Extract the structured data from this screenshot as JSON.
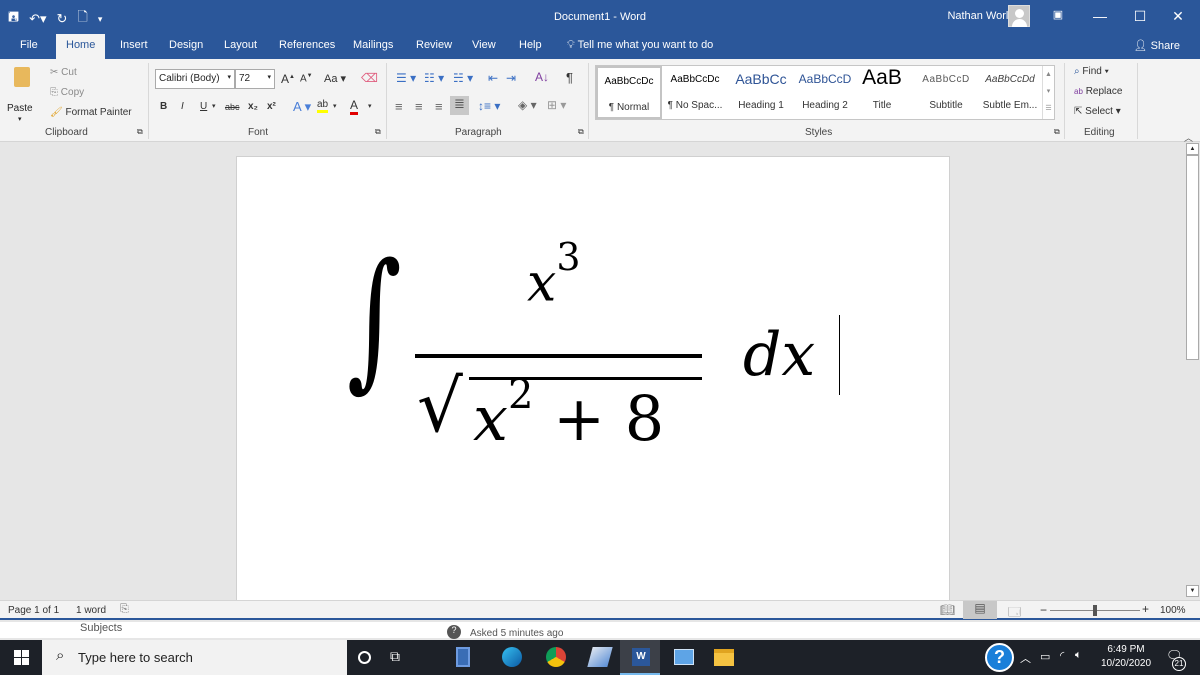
{
  "window": {
    "title": "Document1  -  Word",
    "user_name": "Nathan Worley"
  },
  "quick_access": [
    "save-icon",
    "undo-icon",
    "redo-icon",
    "print-preview-icon",
    "customize-icon"
  ],
  "tabs": [
    {
      "label": "File"
    },
    {
      "label": "Home",
      "active": true
    },
    {
      "label": "Insert"
    },
    {
      "label": "Design"
    },
    {
      "label": "Layout"
    },
    {
      "label": "References"
    },
    {
      "label": "Mailings"
    },
    {
      "label": "Review"
    },
    {
      "label": "View"
    },
    {
      "label": "Help"
    }
  ],
  "tell_me": "Tell me what you want to do",
  "share_label": "Share",
  "ribbon": {
    "clipboard": {
      "paste": "Paste",
      "cut": "Cut",
      "copy": "Copy",
      "format_painter": "Format Painter",
      "label": "Clipboard"
    },
    "font": {
      "name": "Calibri (Body)",
      "size": "72",
      "label": "Font",
      "change_case": "Aa",
      "bold": "B",
      "italic": "I",
      "underline": "U",
      "strike": "abc",
      "sub": "x₂",
      "sup": "x²"
    },
    "paragraph": {
      "label": "Paragraph"
    },
    "styles": {
      "label": "Styles",
      "items": [
        {
          "preview": "AaBbCcDc",
          "name": "¶ Normal"
        },
        {
          "preview": "AaBbCcDc",
          "name": "¶ No Spac..."
        },
        {
          "preview": "AaBbCc",
          "name": "Heading 1"
        },
        {
          "preview": "AaBbCcD",
          "name": "Heading 2"
        },
        {
          "preview": "AaB",
          "name": "Title"
        },
        {
          "preview": "AaBbCcD",
          "name": "Subtitle"
        },
        {
          "preview": "AaBbCcDd",
          "name": "Subtle Em..."
        }
      ]
    },
    "editing": {
      "find": "Find",
      "replace": "Replace",
      "select": "Select",
      "label": "Editing"
    }
  },
  "document": {
    "equation": {
      "integral": "∫",
      "numerator_base": "x",
      "numerator_exp": "3",
      "denominator_base": "x",
      "denominator_exp": "2",
      "denominator_rest": "+ 8",
      "differential": "dx"
    }
  },
  "status": {
    "page": "Page 1 of 1",
    "words": "1 word",
    "zoom": "100%",
    "zoom_minus": "−",
    "zoom_plus": "+"
  },
  "background_page": {
    "subjects": "Subjects",
    "asked": "Asked 5 minutes ago"
  },
  "taskbar": {
    "search_placeholder": "Type here to search",
    "time": "6:49 PM",
    "date": "10/20/2020",
    "notifications": "21"
  }
}
